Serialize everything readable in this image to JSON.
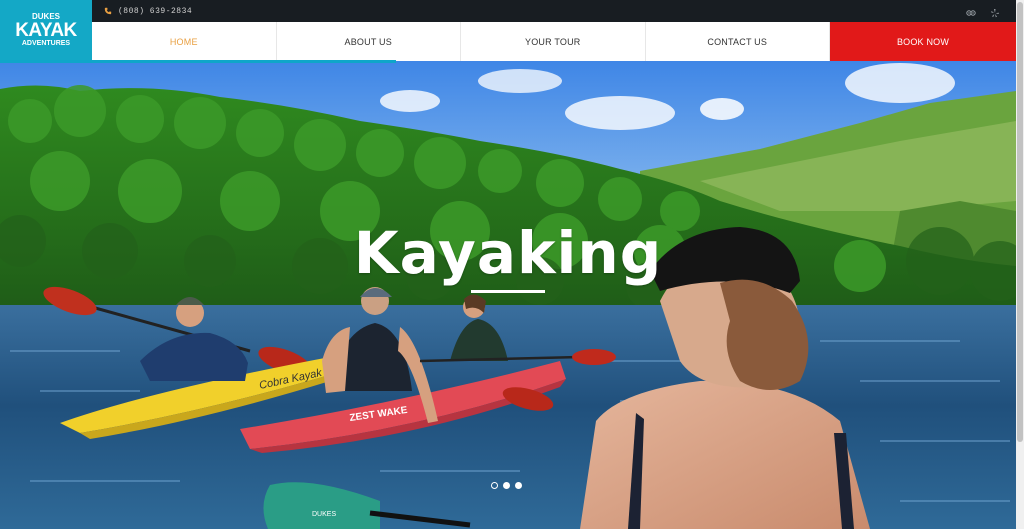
{
  "header": {
    "phone": "(808) 639-2834",
    "logo": {
      "line1": "DUKES",
      "line2": "KAYAK",
      "line3": "ADVENTURES"
    }
  },
  "nav": {
    "items": [
      {
        "label": "HOME"
      },
      {
        "label": "ABOUT US"
      },
      {
        "label": "YOUR TOUR"
      },
      {
        "label": "CONTACT US"
      },
      {
        "label": "BOOK NOW"
      }
    ]
  },
  "hero": {
    "title": "Kayaking",
    "slide_count": 3,
    "active_slide": 1,
    "slide_progress": 0.39,
    "kayak_labels": {
      "yellow": "Cobra Kayak",
      "red": "ZEST WAKE"
    },
    "paddle_label": "DUKES"
  },
  "colors": {
    "topbar": "#181d22",
    "logo_bg": "#14a8c6",
    "accent": "#e9a043",
    "book_now": "#e11919",
    "progress": "#0ea6c9"
  },
  "icons": [
    "phone-icon",
    "tripadvisor-icon",
    "yelp-icon"
  ]
}
